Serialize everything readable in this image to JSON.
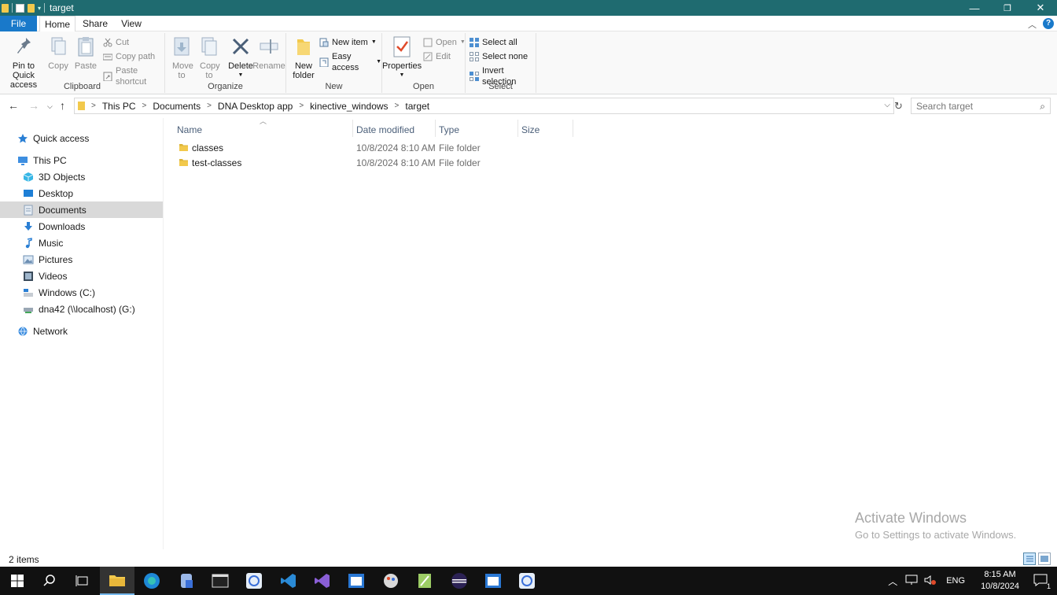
{
  "window": {
    "title": "target",
    "controls": {
      "minimize": "—",
      "restore": "❐",
      "close": "✕"
    }
  },
  "ribbon_tabs": [
    "File",
    "Home",
    "Share",
    "View"
  ],
  "ribbon": {
    "clipboard": {
      "label": "Clipboard",
      "pin_to_quick_access": "Pin to Quick access",
      "copy": "Copy",
      "paste": "Paste",
      "cut": "Cut",
      "copy_path": "Copy path",
      "paste_shortcut": "Paste shortcut"
    },
    "organize": {
      "label": "Organize",
      "move_to": "Move to",
      "copy_to": "Copy to",
      "delete": "Delete",
      "rename": "Rename"
    },
    "new": {
      "label": "New",
      "new_folder": "New folder",
      "new_item": "New item",
      "easy_access": "Easy access"
    },
    "open": {
      "label": "Open",
      "properties": "Properties",
      "open": "Open",
      "edit": "Edit"
    },
    "select": {
      "label": "Select",
      "select_all": "Select all",
      "select_none": "Select none",
      "invert_selection": "Invert selection"
    }
  },
  "address": {
    "crumbs": [
      "This PC",
      "Documents",
      "DNA Desktop app",
      "kinective_windows",
      "target"
    ],
    "search_placeholder": "Search target"
  },
  "nav_pane": {
    "quick_access": "Quick access",
    "this_pc": "This PC",
    "items": [
      {
        "label": "3D Objects",
        "icon": "3d-objects-icon"
      },
      {
        "label": "Desktop",
        "icon": "desktop-icon"
      },
      {
        "label": "Documents",
        "icon": "documents-icon",
        "selected": true
      },
      {
        "label": "Downloads",
        "icon": "downloads-icon"
      },
      {
        "label": "Music",
        "icon": "music-icon"
      },
      {
        "label": "Pictures",
        "icon": "pictures-icon"
      },
      {
        "label": "Videos",
        "icon": "videos-icon"
      },
      {
        "label": "Windows (C:)",
        "icon": "drive-icon"
      },
      {
        "label": "dna42 (\\\\localhost) (G:)",
        "icon": "network-drive-icon"
      }
    ],
    "network": "Network"
  },
  "columns": {
    "name": "Name",
    "date": "Date modified",
    "type": "Type",
    "size": "Size"
  },
  "files": [
    {
      "name": "classes",
      "date": "10/8/2024 8:10 AM",
      "type": "File folder"
    },
    {
      "name": "test-classes",
      "date": "10/8/2024 8:10 AM",
      "type": "File folder"
    }
  ],
  "watermark": {
    "line1": "Activate Windows",
    "line2": "Go to Settings to activate Windows."
  },
  "status": {
    "count": "2 items"
  },
  "taskbar": {
    "language": "ENG",
    "time": "8:15 AM",
    "date": "10/8/2024",
    "notifications": "1"
  },
  "colors": {
    "titlebar": "#1f6b70",
    "file_tab": "#1979ca",
    "folder": "#f2c94c",
    "selected_nav": "#d9d9d9",
    "taskbar": "#111111"
  }
}
